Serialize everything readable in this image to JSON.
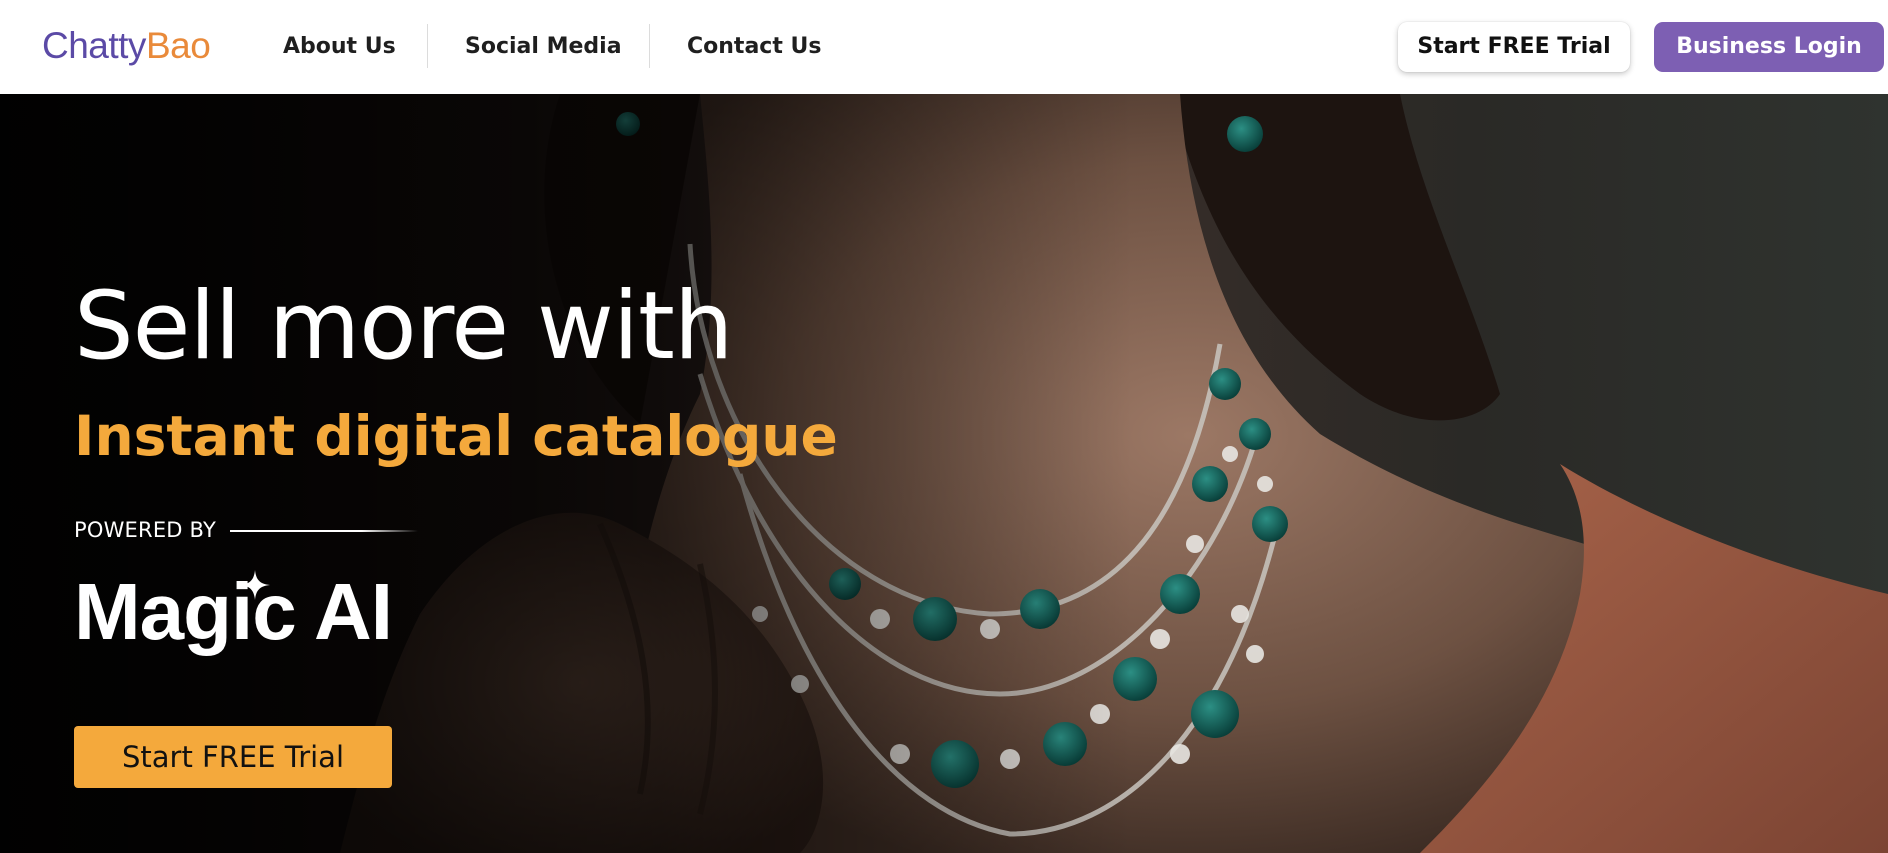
{
  "nav": {
    "logo_part1": "Chatty",
    "logo_part2": "Bao",
    "links": [
      "About Us",
      "Social Media",
      "Contact Us"
    ],
    "trial_button": "Start FREE Trial",
    "login_button": "Business Login"
  },
  "hero": {
    "headline": "Sell more with",
    "subheadline": "Instant digital catalogue",
    "powered_by": "POWERED BY",
    "magic_ai": "Magic AI",
    "cta_button": "Start FREE Trial"
  },
  "colors": {
    "logo_purple": "#5b4aa6",
    "logo_orange": "#e98a3a",
    "accent_orange": "#f4a93c",
    "login_purple": "#7d5fb3"
  },
  "icons": {
    "sparkle": "sparkle-icon"
  }
}
